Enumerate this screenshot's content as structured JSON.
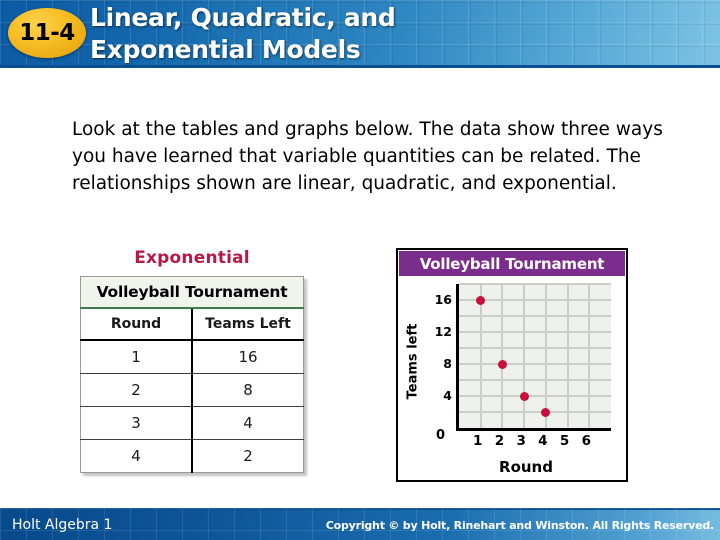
{
  "header": {
    "lesson_badge": "11-4",
    "title_line1": "Linear, Quadratic, and",
    "title_line2": "Exponential Models",
    "accent_color": "#1569ad",
    "badge_color": "#f6bc22"
  },
  "body": {
    "paragraph": "Look at the tables and graphs below. The data show three ways you have learned that variable quantities can be related. The relationships shown are linear, quadratic, and exponential."
  },
  "table_block": {
    "caption": "Exponential",
    "caption_color": "#b31b46",
    "title": "Volleyball Tournament",
    "columns": [
      "Round",
      "Teams Left"
    ],
    "rows": [
      [
        "1",
        "16"
      ],
      [
        "2",
        "8"
      ],
      [
        "3",
        "4"
      ],
      [
        "4",
        "2"
      ]
    ]
  },
  "chart_panel": {
    "title": "Volleyball Tournament",
    "title_bar_color": "#7b2d8e"
  },
  "footer": {
    "left": "Holt Algebra 1",
    "right": "Copyright © by Holt, Rinehart and Winston. All Rights Reserved."
  },
  "chart_data": {
    "type": "scatter",
    "title": "Volleyball Tournament",
    "xlabel": "Round",
    "ylabel": "Teams left",
    "x": [
      1,
      2,
      3,
      4
    ],
    "values": [
      16,
      8,
      4,
      2
    ],
    "series": [
      {
        "name": "Teams left",
        "values": [
          16,
          8,
          4,
          2
        ]
      }
    ],
    "xticks": [
      "1",
      "2",
      "3",
      "4",
      "5",
      "6"
    ],
    "yticks": [
      "4",
      "8",
      "12",
      "16"
    ],
    "origin_label": "0",
    "xlim": [
      0,
      7
    ],
    "ylim": [
      0,
      18
    ],
    "grid": true,
    "legend": "none",
    "point_color": "#c8103c",
    "plot_background": "#eef1ec",
    "gridline_color": "#c9cec8"
  }
}
